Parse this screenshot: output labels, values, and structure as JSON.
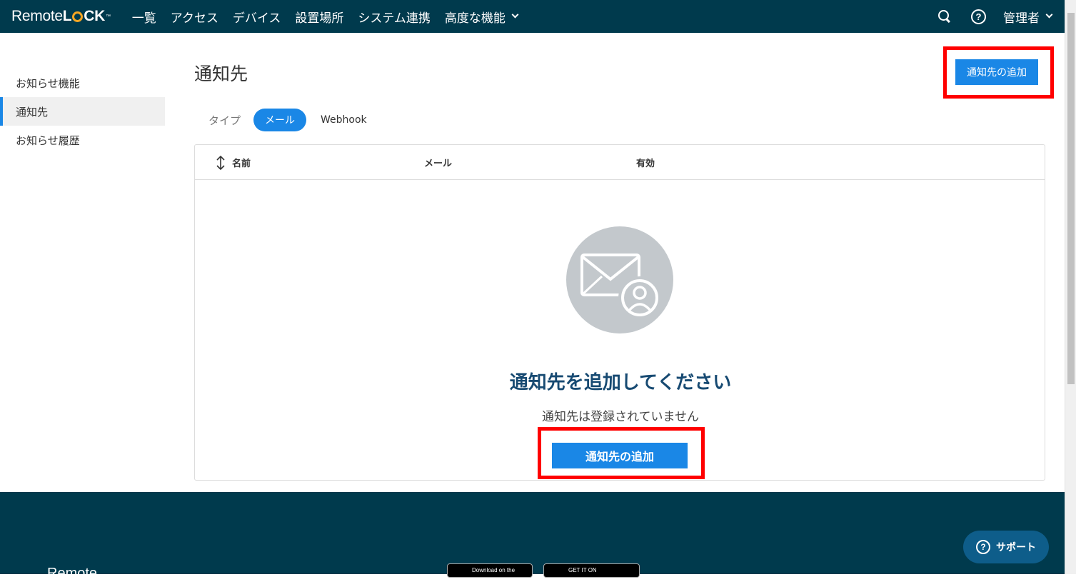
{
  "brand": {
    "name_part1": "Remote",
    "name_part2a": "L",
    "name_part2b": "CK",
    "tm": "™"
  },
  "nav": {
    "items": [
      "一覧",
      "アクセス",
      "デバイス",
      "設置場所",
      "システム連携",
      "高度な機能"
    ]
  },
  "user": {
    "label": "管理者"
  },
  "help": {
    "glyph": "?"
  },
  "sidebar": {
    "items": [
      {
        "label": "お知らせ機能"
      },
      {
        "label": "通知先"
      },
      {
        "label": "お知らせ履歴"
      }
    ]
  },
  "page": {
    "title": "通知先",
    "add_button_label": "通知先の追加"
  },
  "tabs": {
    "label": "タイプ",
    "items": [
      "メール",
      "Webhook"
    ],
    "selected": "メール"
  },
  "table": {
    "columns": [
      "名前",
      "メール",
      "有効"
    ]
  },
  "empty_state": {
    "icon": "mail-user-icon",
    "title": "通知先を追加してください",
    "subtitle": "通知先は登録されていません",
    "button_label": "通知先の追加"
  },
  "support": {
    "label": "サポート",
    "glyph": "?"
  },
  "stores": {
    "apple": "Download on the",
    "google": "GET IT ON"
  },
  "colors": {
    "header_bg": "#003a4d",
    "accent": "#1a87e6",
    "highlight": "#ff0000",
    "empty_title": "#174a72"
  }
}
